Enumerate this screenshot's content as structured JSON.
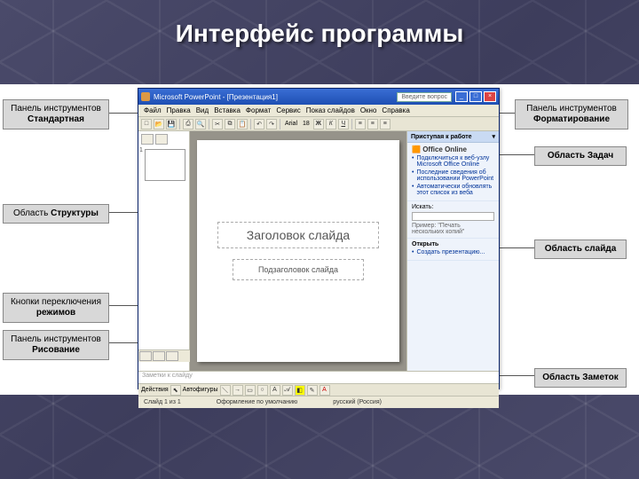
{
  "page_title": "Интерфейс программы",
  "labels": {
    "left1_line1": "Панель инструментов",
    "left1_line2": "Стандартная",
    "left2_line1": "Область",
    "left2_line2": "Структуры",
    "left3_line1": "Кнопки переключения",
    "left3_line2": "режимов",
    "left4_line1": "Панель инструментов",
    "left4_line2": "Рисование",
    "right1_line1": "Панель инструментов",
    "right1_line2": "Форматирование",
    "right2": "Область Задач",
    "right3": "Область слайда",
    "right4": "Область Заметок"
  },
  "app": {
    "title": "Microsoft PowerPoint - [Презентация1]",
    "ask": "Введите вопрос",
    "menu": [
      "Файл",
      "Правка",
      "Вид",
      "Вставка",
      "Формат",
      "Сервис",
      "Показ слайдов",
      "Окно",
      "Справка"
    ],
    "slide_title": "Заголовок слайда",
    "slide_subtitle": "Подзаголовок слайда",
    "notes_placeholder": "Заметки к слайду",
    "status_slide": "Слайд 1 из 1",
    "status_design": "Оформление по умолчанию",
    "status_lang": "русский (Россия)",
    "draw_label": "Действия",
    "autoshapes": "Автофигуры"
  },
  "taskpane": {
    "header": "Приступая к работе",
    "logo": "Office Online",
    "items": [
      "Подключиться к веб-узлу Microsoft Office Online",
      "Последние сведения об использовании PowerPoint",
      "Автоматически обновлять этот список из веба"
    ],
    "search": "Искать:",
    "example": "Пример: \"Печать нескольких копий\"",
    "open": "Открыть",
    "recent": "Создать презентацию..."
  }
}
